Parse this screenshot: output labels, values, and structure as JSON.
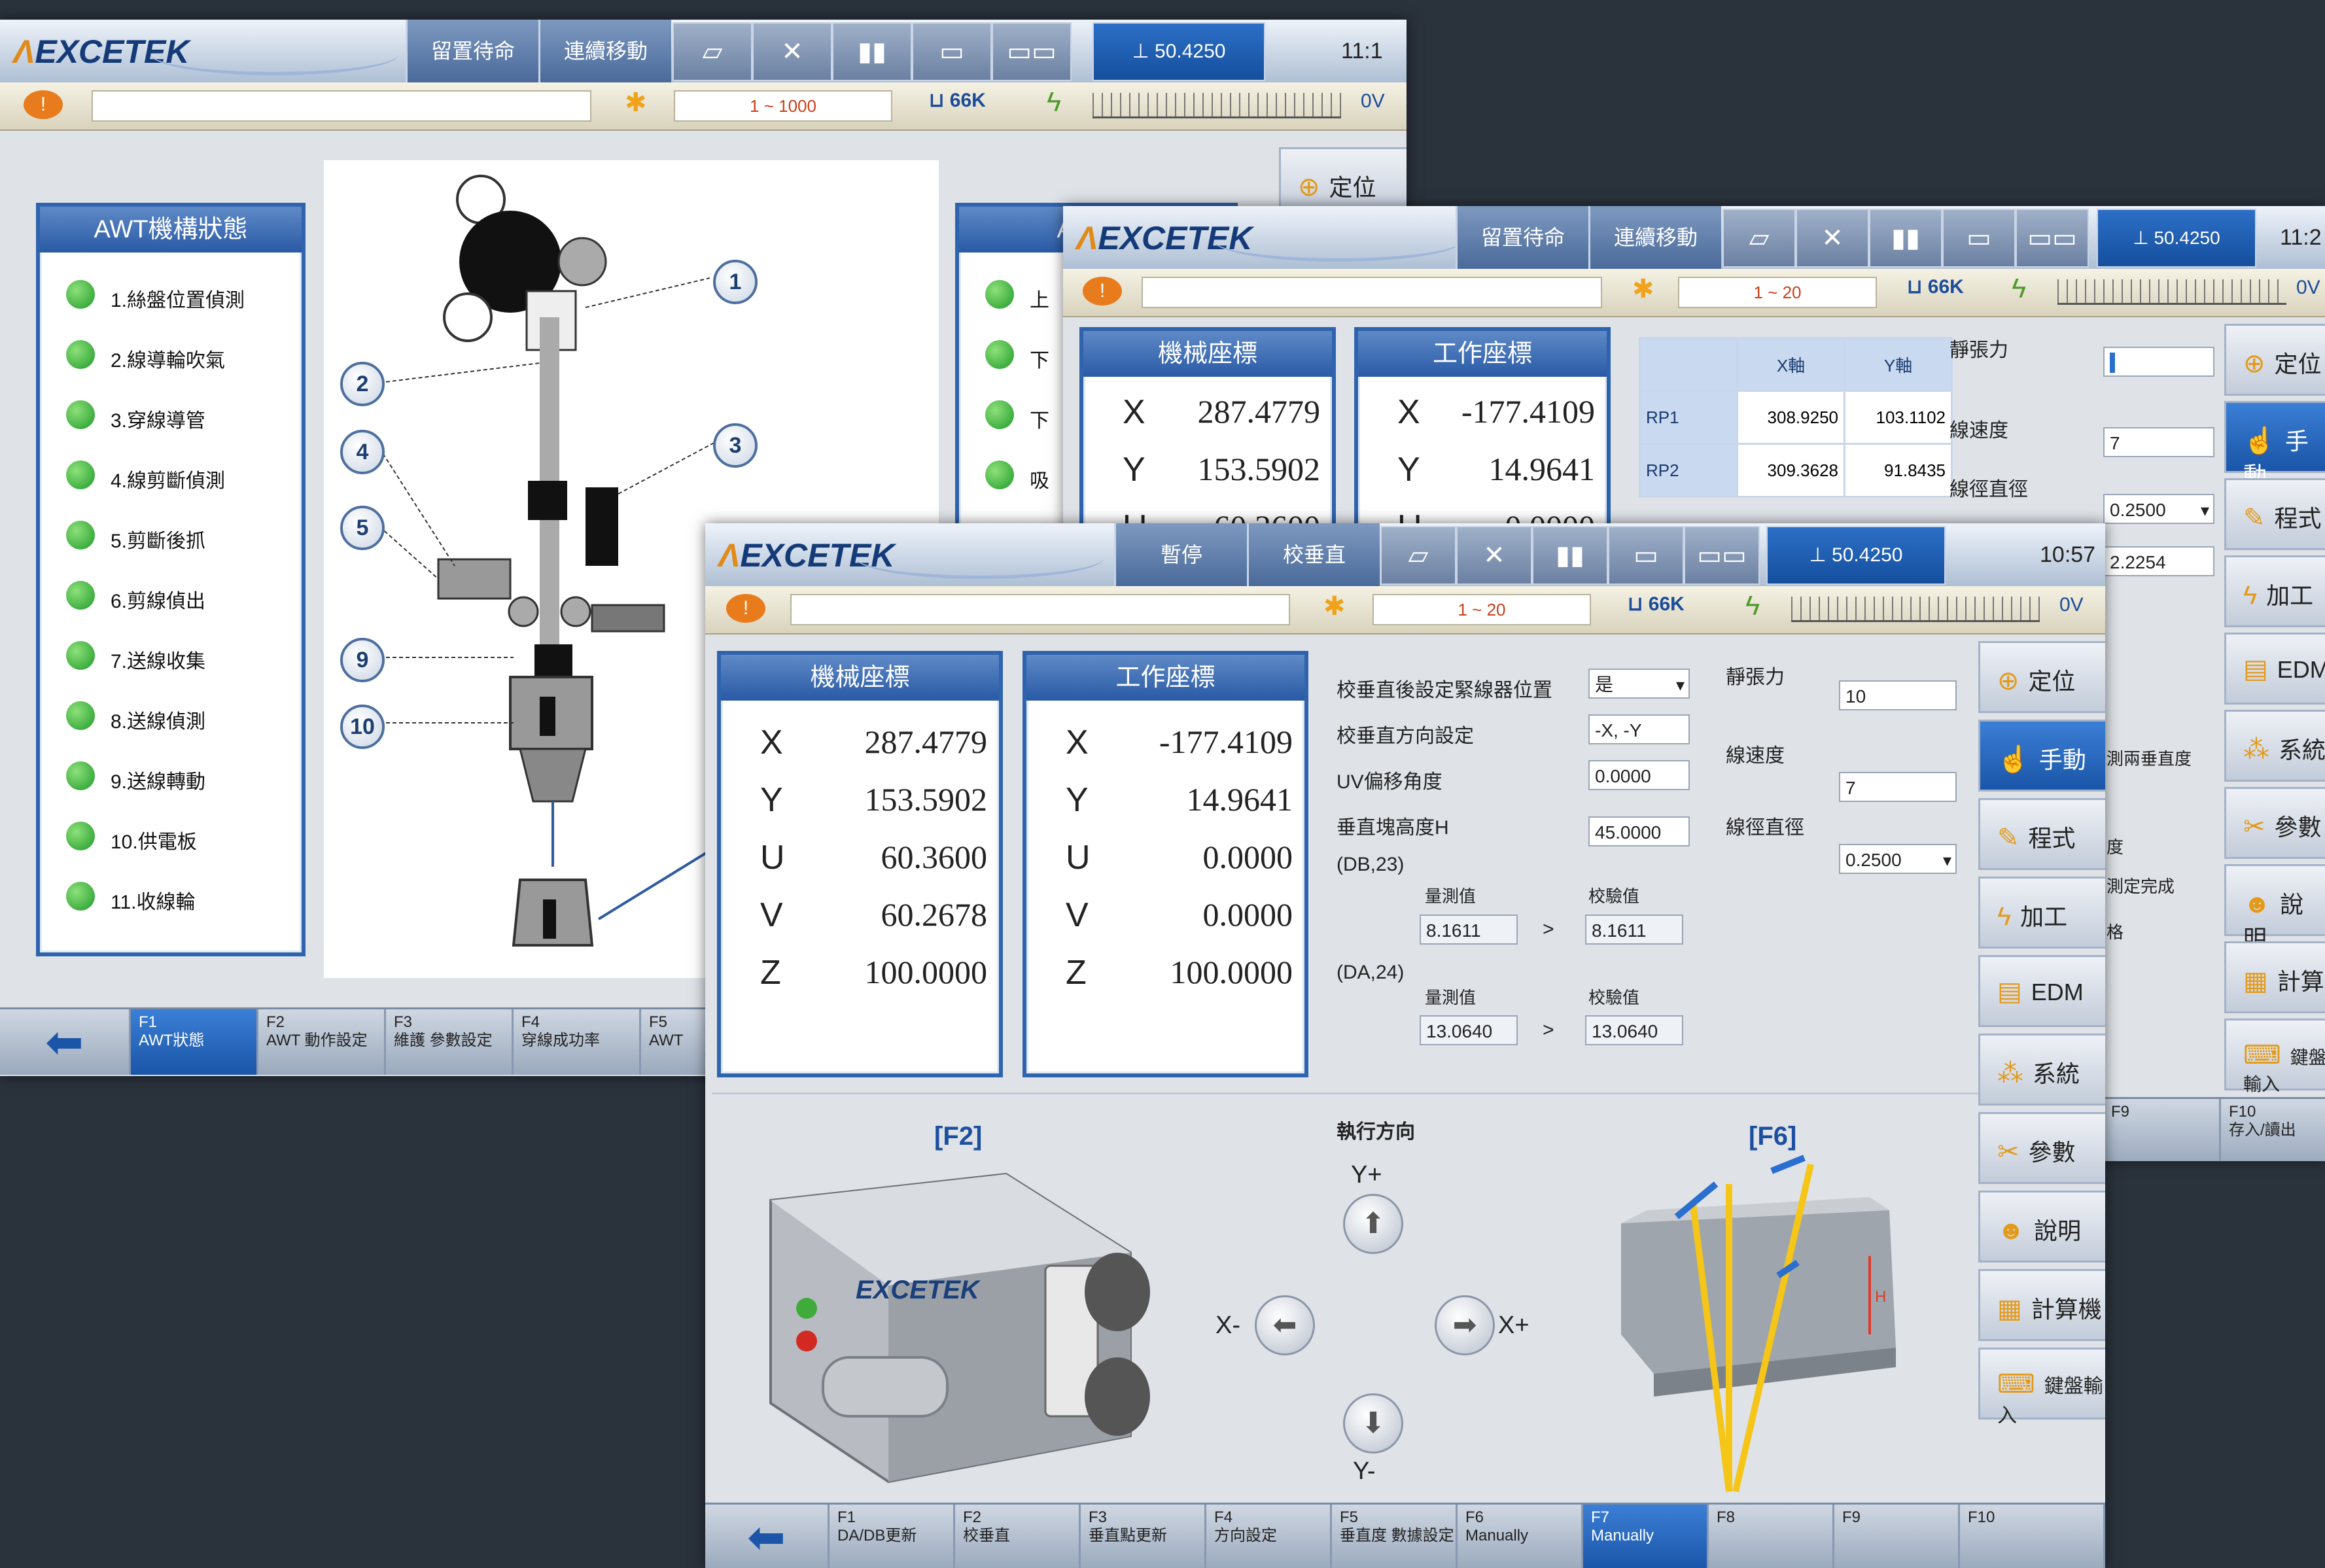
{
  "app": {
    "brand": "EXCETEK"
  },
  "win1": {
    "modes": [
      "留置待命",
      "連續移動"
    ],
    "toolbar_readout": "50.4250",
    "time": "11:1",
    "speed_range": "1 ~ 1000",
    "tank": "66K",
    "voltage": "0V",
    "scale_ticks": [
      "0",
      "100",
      "200"
    ],
    "side_btn": "定位",
    "status_panel_title": "AWT機構狀態",
    "status_items": [
      "1.絲盤位置偵測",
      "2.線導輪吹氣",
      "3.穿線導管",
      "4.線剪斷偵測",
      "5.剪斷後抓",
      "6.剪線偵出",
      "7.送線收集",
      "8.送線偵測",
      "9.送線轉動",
      "10.供電板",
      "11.收線輪"
    ],
    "panel2_title": "AWT狀",
    "panel2_items": [
      "上",
      "下",
      "下",
      "吸"
    ],
    "callouts": [
      "1",
      "2",
      "3",
      "4",
      "5",
      "9",
      "10"
    ],
    "fkeys": [
      {
        "num": "F1",
        "label": "AWT狀態"
      },
      {
        "num": "F2",
        "label": "AWT 動作設定"
      },
      {
        "num": "F3",
        "label": "維護 參數設定"
      },
      {
        "num": "F4",
        "label": "穿線成功率"
      },
      {
        "num": "F5",
        "label": "AWT"
      }
    ]
  },
  "win2": {
    "modes": [
      "留置待命",
      "連續移動"
    ],
    "toolbar_readout": "50.4250",
    "time": "11:2",
    "speed_range": "1 ~ 20",
    "tank": "66K",
    "voltage": "0V",
    "machine_title": "機械座標",
    "work_title": "工作座標",
    "machine_coords": [
      {
        "axis": "X",
        "value": "287.4779"
      },
      {
        "axis": "Y",
        "value": "153.5902"
      },
      {
        "axis": "U",
        "value": "60.3600"
      }
    ],
    "work_coords": [
      {
        "axis": "X",
        "value": "-177.4109"
      },
      {
        "axis": "Y",
        "value": "14.9641"
      },
      {
        "axis": "U",
        "value": "0.0000"
      }
    ],
    "table_headers": [
      "",
      "X軸",
      "Y軸"
    ],
    "table_rows": [
      {
        "label": "RP1",
        "x": "308.9250",
        "y": "103.1102"
      },
      {
        "label": "RP2",
        "x": "309.3628",
        "y": "91.8435"
      }
    ],
    "label_force": "靜張力",
    "label_speed": "線速度",
    "label_dia": "線徑直徑",
    "val_speed": "7",
    "val_dia": "0.2500",
    "val_extra": "2.2254",
    "side_buttons": [
      "定位",
      "手動",
      "程式",
      "加工",
      "EDM",
      "系統",
      "參數",
      "說明",
      "計算",
      "鍵盤輸入"
    ],
    "partial_labels": [
      "測兩垂直度",
      "度",
      "測定完成",
      "格"
    ],
    "fkeys": [
      {
        "num": "F9",
        "label": ""
      },
      {
        "num": "F10",
        "label": "存入/讀出"
      }
    ]
  },
  "win3": {
    "modes": [
      "暫停",
      "校垂直"
    ],
    "toolbar_readout": "50.4250",
    "time": "10:57",
    "speed_range": "1 ~ 20",
    "tank": "66K",
    "voltage": "0V",
    "scale_ticks": [
      "0",
      "100",
      "200"
    ],
    "machine_title": "機械座標",
    "work_title": "工作座標",
    "machine_coords": [
      {
        "axis": "X",
        "value": "287.4779"
      },
      {
        "axis": "Y",
        "value": "153.5902"
      },
      {
        "axis": "U",
        "value": "60.3600"
      },
      {
        "axis": "V",
        "value": "60.2678"
      },
      {
        "axis": "Z",
        "value": "100.0000"
      }
    ],
    "work_coords": [
      {
        "axis": "X",
        "value": "-177.4109"
      },
      {
        "axis": "Y",
        "value": "14.9641"
      },
      {
        "axis": "U",
        "value": "0.0000"
      },
      {
        "axis": "V",
        "value": "0.0000"
      },
      {
        "axis": "Z",
        "value": "100.0000"
      }
    ],
    "settings": {
      "l1": "校垂直後設定緊線器位置",
      "v1": "是",
      "l2": "校垂直方向設定",
      "v2": "-X, -Y",
      "l3": "UV偏移角度",
      "v3": "0.0000",
      "l4": "垂直塊高度H",
      "v4": "45.0000",
      "da23": "(DB,23)",
      "da24": "(DA,24)",
      "meas": "量測值",
      "calc": "校驗值",
      "m1": "8.1611",
      "c1": "8.1611",
      "m2": "13.0640",
      "c2": "13.0640",
      "force_label": "靜張力",
      "force": "10",
      "speed_label": "線速度",
      "speed": "7",
      "dia_label": "線徑直徑",
      "dia": "0.2500"
    },
    "img_left_label": "[F2]",
    "img_right_label": "[F6]",
    "direction_title": "執行方向",
    "dir_up": "Y+",
    "dir_down": "Y-",
    "dir_left": "X-",
    "dir_right": "X+",
    "device_brand": "EXCETEK",
    "side_buttons": [
      "定位",
      "手動",
      "程式",
      "加工",
      "EDM",
      "系統",
      "參數",
      "說明",
      "計算機",
      "鍵盤輸入"
    ],
    "fkeys": [
      {
        "num": "F1",
        "label": "DA/DB更新"
      },
      {
        "num": "F2",
        "label": "校垂直"
      },
      {
        "num": "F3",
        "label": "垂直點更新"
      },
      {
        "num": "F4",
        "label": "方向設定"
      },
      {
        "num": "F5",
        "label": "垂直度 數據設定"
      },
      {
        "num": "F6",
        "label": "Manually"
      },
      {
        "num": "F7",
        "label": "Manually"
      },
      {
        "num": "F8",
        "label": ""
      },
      {
        "num": "F9",
        "label": ""
      },
      {
        "num": "F10",
        "label": ""
      }
    ]
  }
}
